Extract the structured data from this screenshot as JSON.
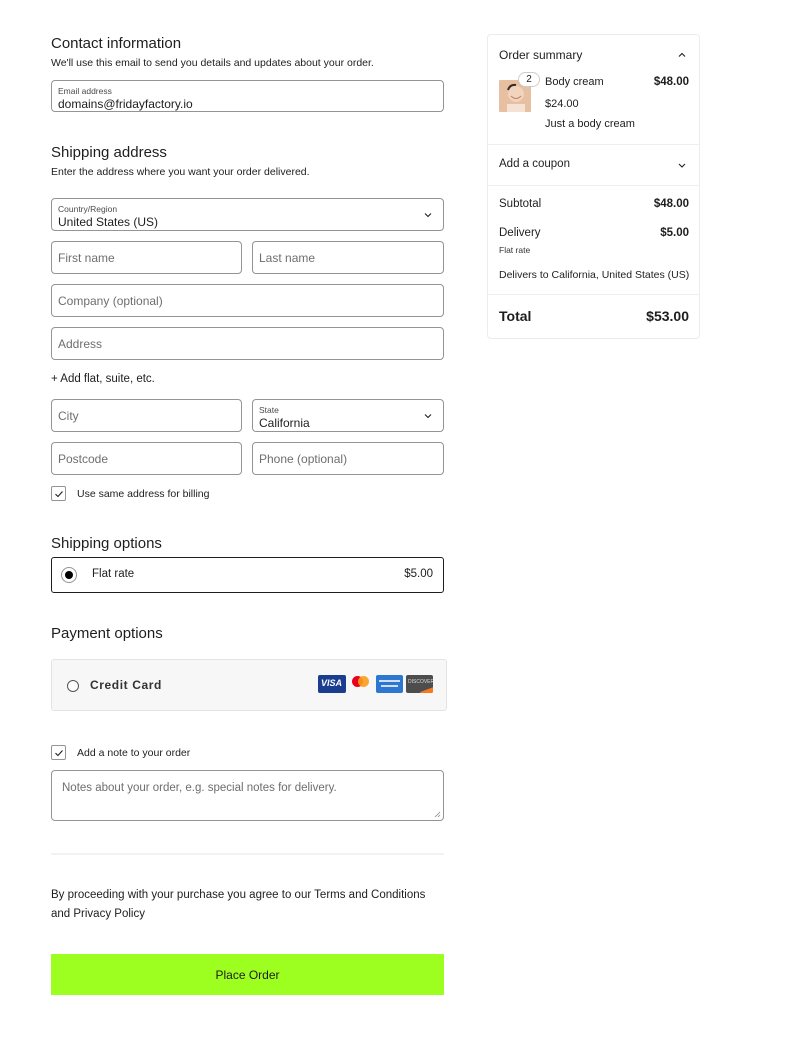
{
  "contact": {
    "title": "Contact information",
    "description": "We'll use this email to send you details and updates about your order.",
    "email": {
      "label": "Email address",
      "value": "domains@fridayfactory.io"
    }
  },
  "shipping_address": {
    "title": "Shipping address",
    "description": "Enter the address where you want your order delivered.",
    "country": {
      "label": "Country/Region",
      "value": "United States (US)",
      "icon": "chevron-down-icon"
    },
    "first_name": {
      "placeholder": "First name"
    },
    "last_name": {
      "placeholder": "Last name"
    },
    "company": {
      "placeholder": "Company (optional)"
    },
    "address": {
      "placeholder": "Address"
    },
    "add_address_line": "+ Add flat, suite, etc.",
    "city": {
      "placeholder": "City"
    },
    "state": {
      "label": "State",
      "value": "California",
      "icon": "chevron-down-icon"
    },
    "postcode": {
      "placeholder": "Postcode"
    },
    "phone": {
      "placeholder": "Phone (optional)"
    },
    "same_billing": {
      "label": "Use same address for billing",
      "checked": true
    }
  },
  "shipping_options": {
    "title": "Shipping options",
    "options": [
      {
        "label": "Flat rate",
        "price": "$5.00",
        "selected": true
      }
    ]
  },
  "payment_options": {
    "title": "Payment options",
    "methods": [
      {
        "label": "Credit Card",
        "selected": false,
        "card_icons": [
          "visa-icon",
          "mastercard-icon",
          "amex-icon",
          "discover-icon"
        ],
        "card_texts": {
          "visa": "VISA",
          "discover": "DISCOVER"
        }
      }
    ]
  },
  "order_note": {
    "checkbox_label": "Add a note to your order",
    "checked": true,
    "placeholder": "Notes about your order, e.g. special notes for delivery."
  },
  "terms_text": "By proceeding with your purchase you agree to our Terms and Conditions and Privacy Policy",
  "place_order": {
    "label": "Place Order",
    "color": "#9dff1f"
  },
  "order_summary": {
    "title": "Order summary",
    "expanded": true,
    "items": [
      {
        "name": "Body cream",
        "quantity": "2",
        "unit_price": "$24.00",
        "total": "$48.00",
        "description": "Just a body cream"
      }
    ],
    "coupon_label": "Add a coupon",
    "subtotal_label": "Subtotal",
    "subtotal": "$48.00",
    "delivery_label": "Delivery",
    "delivery_value": "$5.00",
    "delivery_method": "Flat rate",
    "delivery_note": "Delivers to California, United States (US)",
    "total_label": "Total",
    "total": "$53.00"
  },
  "colors": {
    "accent": "#9dff1f",
    "border": "#949494",
    "text": "#1e1e1e"
  }
}
